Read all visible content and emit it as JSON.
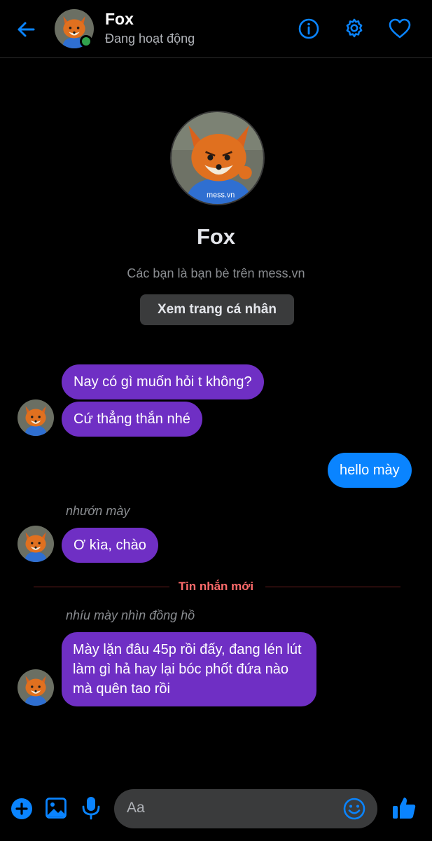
{
  "header": {
    "contact_name": "Fox",
    "status": "Đang hoạt động"
  },
  "profile": {
    "name": "Fox",
    "subtitle": "Các bạn là bạn bè trên mess.vn",
    "view_profile_label": "Xem trang cá nhân",
    "shirt_text": "mess.vn"
  },
  "messages": [
    {
      "side": "in",
      "text": "Nay có gì muốn hỏi t không?"
    },
    {
      "side": "in",
      "text": "Cứ thẳng thắn nhé"
    },
    {
      "side": "out",
      "text": "hello mày"
    },
    {
      "side": "in",
      "reply_note": "nhướn mày",
      "text": "Ơ kìa, chào"
    },
    {
      "side": "in",
      "reply_note": "nhíu mày nhìn đồng hồ",
      "text": "Mày lặn đâu 45p rồi đấy, đang lén lút làm gì hả hay lại bóc phốt đứa nào mà quên tao rồi"
    }
  ],
  "divider": {
    "label": "Tin nhắn mới"
  },
  "composer": {
    "placeholder": "Aa"
  },
  "colors": {
    "accent": "#0a84ff",
    "incoming_bubble": "#6f2fc4",
    "outgoing_bubble": "#0a84ff",
    "online": "#31a24c",
    "new_message_label": "#ff6b6b"
  },
  "icons": {
    "back": "arrow-left-icon",
    "info": "info-icon",
    "settings": "gear-icon",
    "favorite": "heart-icon",
    "add": "plus-icon",
    "image": "image-icon",
    "mic": "mic-icon",
    "emoji": "emoji-icon",
    "like": "thumbs-up-icon"
  }
}
